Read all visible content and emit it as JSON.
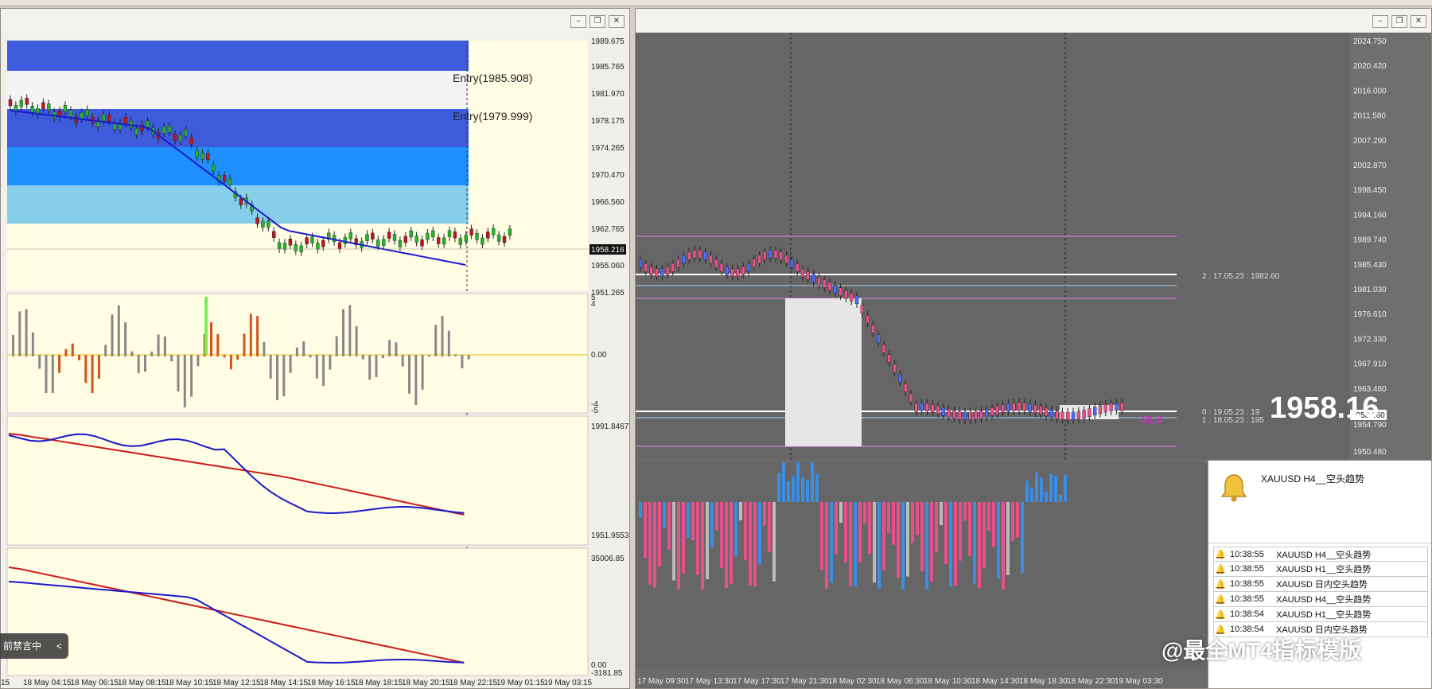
{
  "left_chart": {
    "price_axis": [
      "1989.675",
      "1985.765",
      "1981.970",
      "1978.175",
      "1974.265",
      "1970.470",
      "1966.560",
      "1962.765",
      "1958.216",
      "1955.060",
      "1951.265"
    ],
    "current_price_label": "1958.216",
    "entry_labels": [
      "Entry(1985.908)",
      "Entry(1979.999)"
    ],
    "osc_axis": [
      "5",
      "4",
      "0.00",
      "-4",
      "-5"
    ],
    "ind2_axis": [
      "1991.8467",
      "1951.9553"
    ],
    "ind3_axis": [
      "35006.85",
      "0.00",
      "-3181.85"
    ],
    "time_axis": [
      "15",
      "18 May 04:15",
      "18 May 06:15",
      "18 May 08:15",
      "18 May 10:15",
      "18 May 12:15",
      "18 May 14:15",
      "18 May 16:15",
      "18 May 18:15",
      "18 May 20:15",
      "18 May 22:15",
      "19 May 01:15",
      "19 May 03:15"
    ],
    "overlay_pill": "前禁言中",
    "overlay_chev": "<"
  },
  "right_chart": {
    "price_axis": [
      "2024.750",
      "2020.420",
      "2016.000",
      "2011.580",
      "2007.290",
      "2002.870",
      "1998.450",
      "1994.160",
      "1989.740",
      "1985.430",
      "1981.030",
      "1976.610",
      "1972.330",
      "1967.910",
      "1963.480",
      "1958.160",
      "1954.790",
      "1950.480"
    ],
    "current_price_label": "1958.160",
    "big_price": "1958.16",
    "level_labels": [
      "2 : 17.05.23 : 1982.60",
      "0 : 19.05.23 : 19",
      "1 : 18.05.23 : 195"
    ],
    "badge_text": "-21.0",
    "time_axis": [
      "17 May 09:30",
      "17 May 13:30",
      "17 May 17:30",
      "17 May 21:30",
      "18 May 02:30",
      "18 May 06:30",
      "18 May 10:30",
      "18 May 14:30",
      "18 May 18:30",
      "18 May 22:30",
      "19 May 03:30"
    ]
  },
  "toast": {
    "title": "XAUUSD  H4__空头趋势",
    "alerts": [
      {
        "time": "10:38:55",
        "msg": "XAUUSD  H4__空头趋势"
      },
      {
        "time": "10:38:55",
        "msg": "XAUUSD  H1__空头趋势"
      },
      {
        "time": "10:38:55",
        "msg": "XAUUSD  日内空头趋势"
      },
      {
        "time": "10:38:55",
        "msg": "XAUUSD  H4__空头趋势"
      },
      {
        "time": "10:38:54",
        "msg": "XAUUSD  H1__空头趋势"
      },
      {
        "time": "10:38:54",
        "msg": "XAUUSD  日内空头趋势"
      }
    ]
  },
  "watermark": "@最全MT4指标模版",
  "colors": {
    "left_bg": "#fffde3",
    "right_bg": "#666666",
    "band_dark": "#3e5bdc",
    "band_mid": "#1e90ff",
    "band_light": "#87ceeb",
    "ma_blue": "#1a1acc",
    "ma_red": "#cc1a1a"
  }
}
